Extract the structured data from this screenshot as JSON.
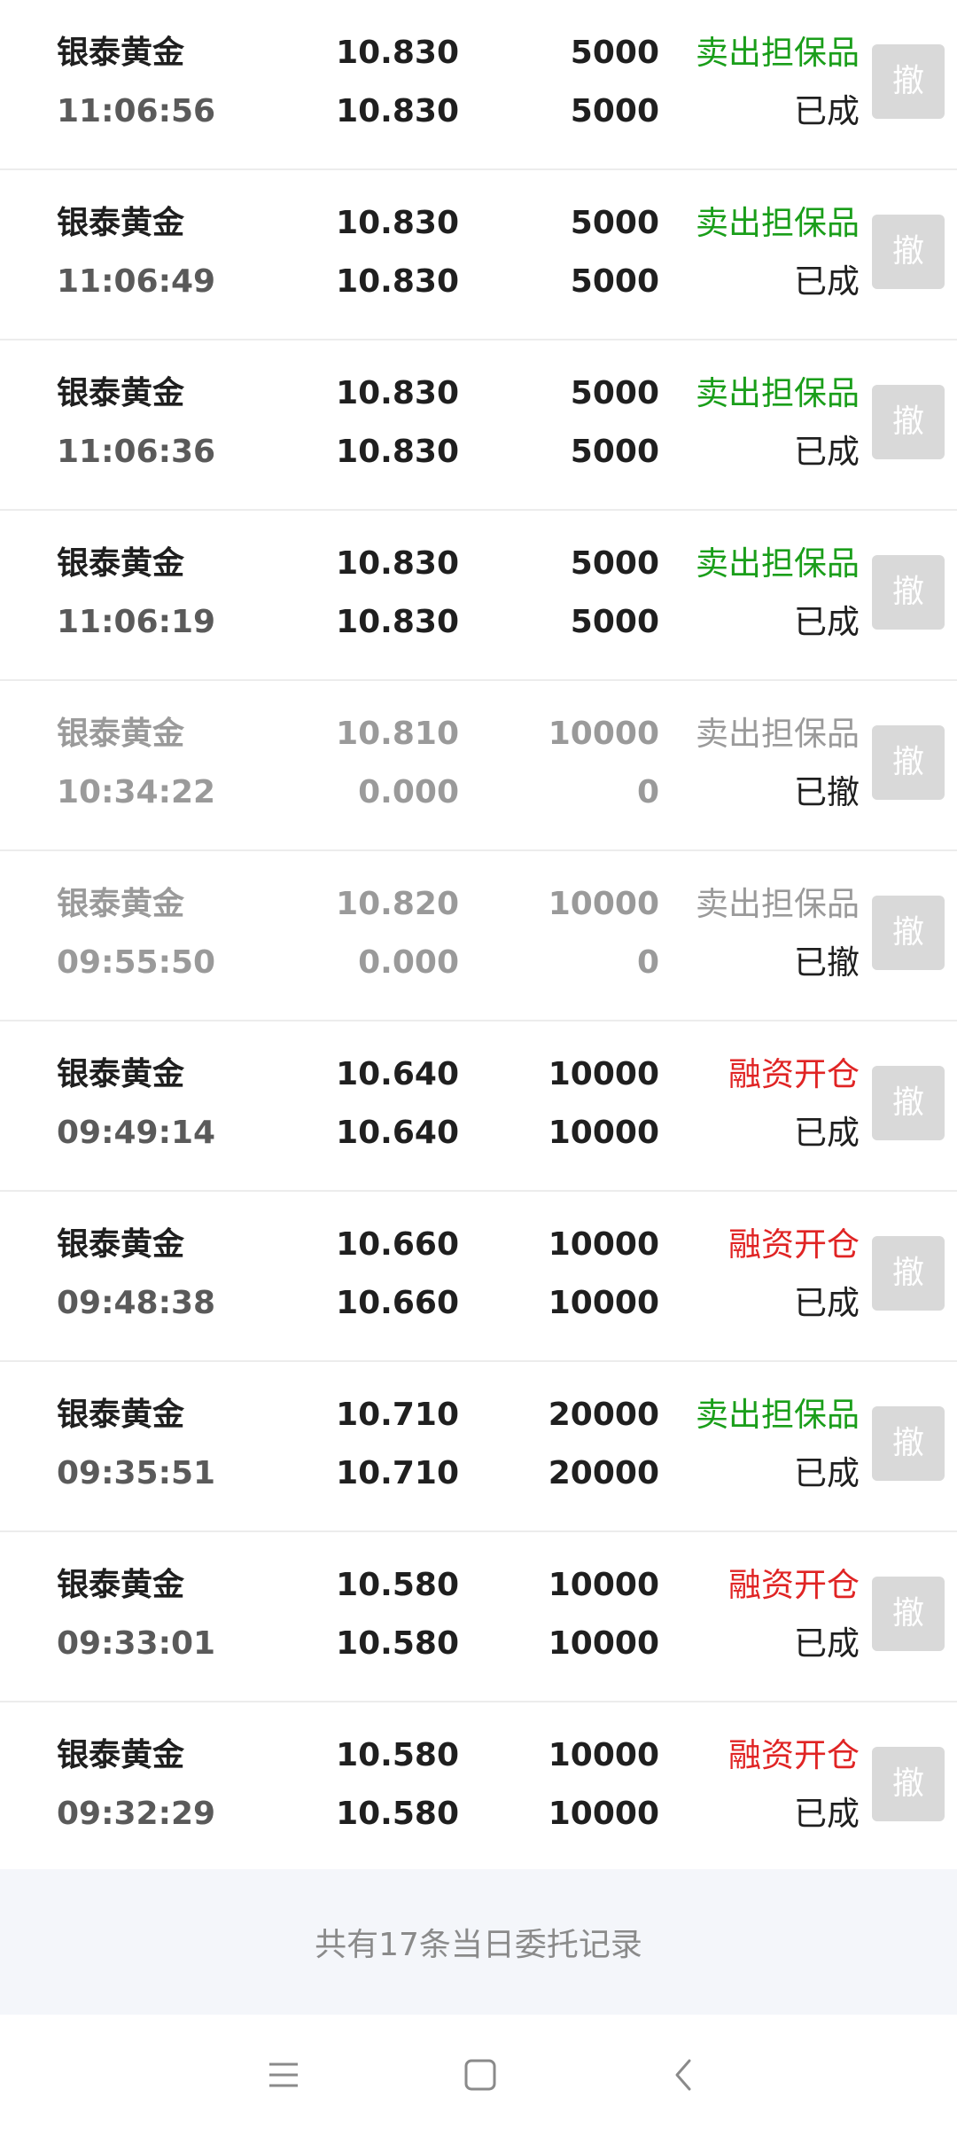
{
  "orders": [
    {
      "name": "银泰黄金",
      "time": "11:06:56",
      "price": "10.830",
      "deal_price": "10.830",
      "qty": "5000",
      "deal_qty": "5000",
      "type": "卖出担保品",
      "type_kind": "sell",
      "status": "已成",
      "cancelled": false,
      "cancel_label": "撤"
    },
    {
      "name": "银泰黄金",
      "time": "11:06:49",
      "price": "10.830",
      "deal_price": "10.830",
      "qty": "5000",
      "deal_qty": "5000",
      "type": "卖出担保品",
      "type_kind": "sell",
      "status": "已成",
      "cancelled": false,
      "cancel_label": "撤"
    },
    {
      "name": "银泰黄金",
      "time": "11:06:36",
      "price": "10.830",
      "deal_price": "10.830",
      "qty": "5000",
      "deal_qty": "5000",
      "type": "卖出担保品",
      "type_kind": "sell",
      "status": "已成",
      "cancelled": false,
      "cancel_label": "撤"
    },
    {
      "name": "银泰黄金",
      "time": "11:06:19",
      "price": "10.830",
      "deal_price": "10.830",
      "qty": "5000",
      "deal_qty": "5000",
      "type": "卖出担保品",
      "type_kind": "sell",
      "status": "已成",
      "cancelled": false,
      "cancel_label": "撤"
    },
    {
      "name": "银泰黄金",
      "time": "10:34:22",
      "price": "10.810",
      "deal_price": "0.000",
      "qty": "10000",
      "deal_qty": "0",
      "type": "卖出担保品",
      "type_kind": "sell",
      "status": "已撤",
      "cancelled": true,
      "cancel_label": "撤"
    },
    {
      "name": "银泰黄金",
      "time": "09:55:50",
      "price": "10.820",
      "deal_price": "0.000",
      "qty": "10000",
      "deal_qty": "0",
      "type": "卖出担保品",
      "type_kind": "sell",
      "status": "已撤",
      "cancelled": true,
      "cancel_label": "撤"
    },
    {
      "name": "银泰黄金",
      "time": "09:49:14",
      "price": "10.640",
      "deal_price": "10.640",
      "qty": "10000",
      "deal_qty": "10000",
      "type": "融资开仓",
      "type_kind": "buy",
      "status": "已成",
      "cancelled": false,
      "cancel_label": "撤"
    },
    {
      "name": "银泰黄金",
      "time": "09:48:38",
      "price": "10.660",
      "deal_price": "10.660",
      "qty": "10000",
      "deal_qty": "10000",
      "type": "融资开仓",
      "type_kind": "buy",
      "status": "已成",
      "cancelled": false,
      "cancel_label": "撤"
    },
    {
      "name": "银泰黄金",
      "time": "09:35:51",
      "price": "10.710",
      "deal_price": "10.710",
      "qty": "20000",
      "deal_qty": "20000",
      "type": "卖出担保品",
      "type_kind": "sell",
      "status": "已成",
      "cancelled": false,
      "cancel_label": "撤"
    },
    {
      "name": "银泰黄金",
      "time": "09:33:01",
      "price": "10.580",
      "deal_price": "10.580",
      "qty": "10000",
      "deal_qty": "10000",
      "type": "融资开仓",
      "type_kind": "buy",
      "status": "已成",
      "cancelled": false,
      "cancel_label": "撤"
    },
    {
      "name": "银泰黄金",
      "time": "09:32:29",
      "price": "10.580",
      "deal_price": "10.580",
      "qty": "10000",
      "deal_qty": "10000",
      "type": "融资开仓",
      "type_kind": "buy",
      "status": "已成",
      "cancelled": false,
      "cancel_label": "撤"
    }
  ],
  "footer": {
    "summary": "共有17条当日委托记录"
  },
  "colors": {
    "sell": "#1a9e1a",
    "buy": "#e02424",
    "muted": "#9a9a9a",
    "footer_bg": "#f4f6fa"
  },
  "navbar": {
    "icons": [
      "menu-icon",
      "home-icon",
      "back-icon"
    ]
  }
}
